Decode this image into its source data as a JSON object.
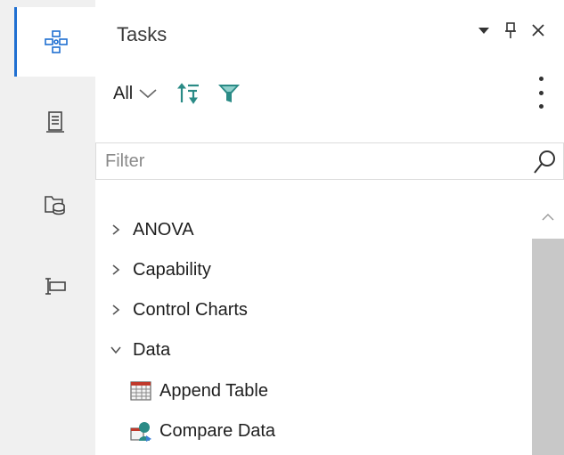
{
  "rail": {
    "items": [
      {
        "name": "tasks",
        "icon": "tasks-network-icon",
        "active": true
      },
      {
        "name": "results",
        "icon": "document-icon",
        "active": false
      },
      {
        "name": "libraries",
        "icon": "folder-database-icon",
        "active": false
      },
      {
        "name": "snippets",
        "icon": "text-cursor-box-icon",
        "active": false
      }
    ]
  },
  "panel": {
    "title": "Tasks",
    "controls": [
      "dropdown-arrow-icon",
      "pin-icon",
      "close-icon"
    ]
  },
  "toolbar": {
    "filter_scope": "All",
    "sort_icon": "sort-icon",
    "funnel_icon": "funnel-icon",
    "more_icon": "kebab-menu-icon"
  },
  "filter": {
    "placeholder": "Filter",
    "value": ""
  },
  "tree": {
    "items": [
      {
        "label": "ANOVA",
        "expanded": false
      },
      {
        "label": "Capability",
        "expanded": false
      },
      {
        "label": "Control Charts",
        "expanded": false
      },
      {
        "label": "Data",
        "expanded": true
      },
      {
        "label": "Append Table",
        "leaf": true,
        "icon": "append-table-icon"
      },
      {
        "label": "Compare Data",
        "leaf": true,
        "icon": "compare-data-icon"
      }
    ]
  },
  "colors": {
    "accent": "#1f6fd1",
    "teal_icon": "#2a8b86",
    "rail_bg": "#f0f0f0",
    "scroll_thumb": "#c8c8c8"
  }
}
